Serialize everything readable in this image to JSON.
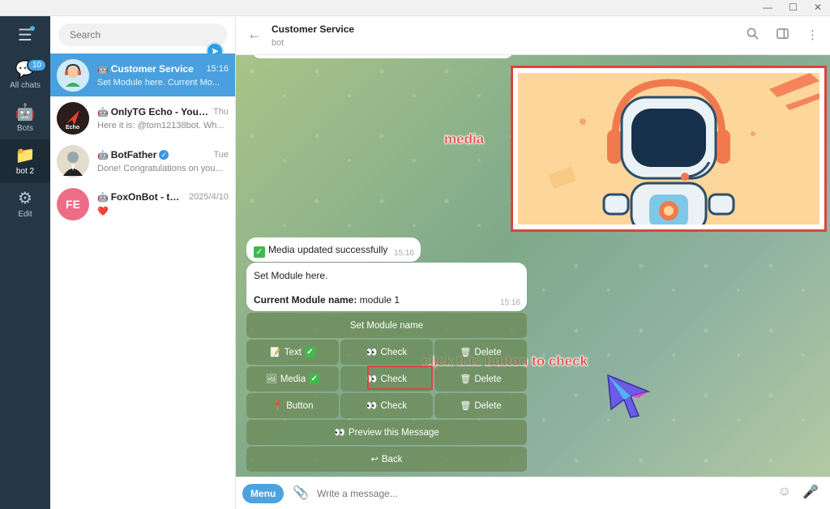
{
  "rail": {
    "items": [
      {
        "label": "All chats",
        "badge": "10"
      },
      {
        "label": "Bots"
      },
      {
        "label": "bot 2"
      },
      {
        "label": "Edit"
      }
    ]
  },
  "search": {
    "placeholder": "Search"
  },
  "chats": [
    {
      "name": "Customer Service",
      "time": "15:16",
      "preview": "Set Module here.  Current Mo..."
    },
    {
      "name": "OnlyTG Echo - Your ...",
      "time": "Thu",
      "preview": "Here it is: @tom12138bot. Wh..."
    },
    {
      "name": "BotFather",
      "time": "Tue",
      "preview": "Done! Congratulations on you..."
    },
    {
      "name": "FoxOnBot - tes...",
      "time": "2025/4/10",
      "preview": "❤️",
      "initials": "FE"
    }
  ],
  "header": {
    "title": "Customer Service",
    "subtitle": "bot"
  },
  "annotations": {
    "media": "media",
    "check": "click this button to check"
  },
  "messages": {
    "media_updated": "Media updated successfully",
    "media_updated_time": "15:16",
    "module_line1": "Set Module here.",
    "module_label": "Current Module name:",
    "module_value": " module 1",
    "module_time": "15:16"
  },
  "keyboard": {
    "set_module": "Set Module name",
    "text": "Text",
    "media": "Media",
    "button": "Button",
    "check": "Check",
    "delete": "Delete",
    "preview": "Preview this Message",
    "back": "Back"
  },
  "composer": {
    "menu": "Menu",
    "placeholder": "Write a message..."
  }
}
